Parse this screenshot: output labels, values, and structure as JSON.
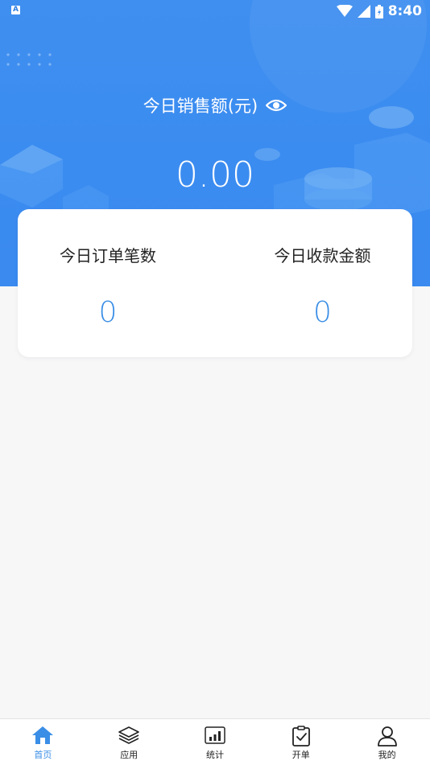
{
  "status_bar": {
    "time": "8:40",
    "notification_letter": "A"
  },
  "header": {
    "sales_label": "今日销售额(元)",
    "sales_value": "0.00"
  },
  "stats": [
    {
      "label": "今日订单笔数",
      "value": "0"
    },
    {
      "label": "今日收款金额",
      "value": "0"
    }
  ],
  "tabs": [
    {
      "label": "首页",
      "icon": "home-icon",
      "active": true
    },
    {
      "label": "应用",
      "icon": "layers-icon",
      "active": false
    },
    {
      "label": "统计",
      "icon": "bar-chart-icon",
      "active": false
    },
    {
      "label": "开单",
      "icon": "clipboard-check-icon",
      "active": false
    },
    {
      "label": "我的",
      "icon": "user-icon",
      "active": false
    }
  ],
  "colors": {
    "primary": "#3a8ee6",
    "hero": "#3b8cf0",
    "background": "#f7f7f8"
  }
}
